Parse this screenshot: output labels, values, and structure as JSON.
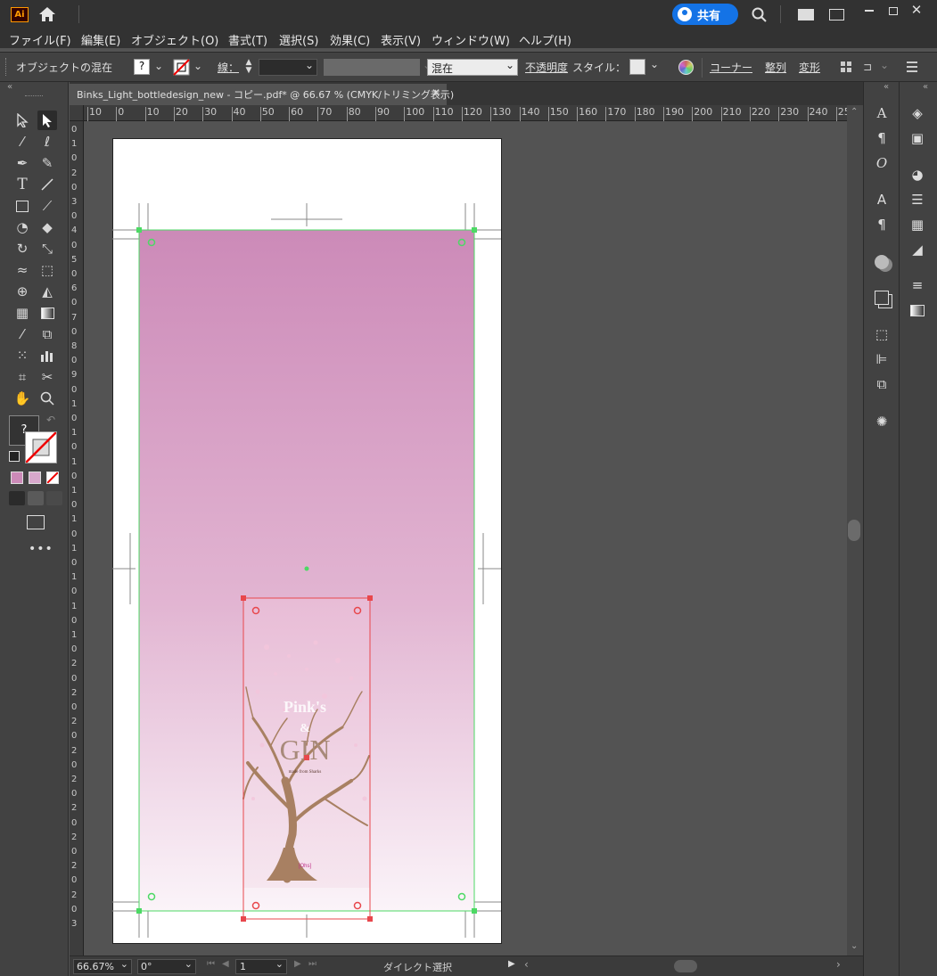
{
  "app": {
    "logo": "Ai",
    "share_label": "共有"
  },
  "menu": [
    "ファイル(F)",
    "編集(E)",
    "オブジェクト(O)",
    "書式(T)",
    "選択(S)",
    "効果(C)",
    "表示(V)",
    "ウィンドウ(W)",
    "ヘルプ(H)"
  ],
  "control": {
    "mode_label": "オブジェクトの混在",
    "fill_label": "?",
    "stroke_label": "線：",
    "blend_value": "混在",
    "opacity_label": "不透明度",
    "style_label": "スタイル：",
    "corner_label": "コーナー",
    "align_label": "整列",
    "transform_label": "変形"
  },
  "document": {
    "tab_title": "Binks_Light_bottledesign_new - コピー.pdf* @ 66.67 % (CMYK/トリミング表示)"
  },
  "ruler": {
    "h_ticks": [
      "10",
      "0",
      "10",
      "20",
      "30",
      "40",
      "50",
      "60",
      "70",
      "80",
      "90",
      "100",
      "110",
      "120",
      "130",
      "140",
      "150",
      "160",
      "170",
      "180",
      "190",
      "200",
      "210",
      "220",
      "230",
      "240",
      "25"
    ],
    "v_ticks": [
      "0",
      "1",
      "0",
      "2",
      "0",
      "3",
      "0",
      "4",
      "0",
      "5",
      "0",
      "6",
      "0",
      "7",
      "0",
      "8",
      "0",
      "9",
      "0",
      "1",
      "0",
      "1",
      "0",
      "1",
      "0",
      "1",
      "0",
      "1",
      "0",
      "1",
      "0",
      "1",
      "0",
      "1",
      "0",
      "1",
      "0",
      "2",
      "0",
      "2",
      "0",
      "2",
      "0",
      "2",
      "0",
      "2",
      "0",
      "2",
      "0",
      "2",
      "0",
      "2",
      "0",
      "2",
      "0",
      "3"
    ]
  },
  "artwork": {
    "label_title_line1": "Pink's",
    "label_title_line2": "&",
    "label_title_main": "GIN",
    "label_subtitle": "made from Sharks",
    "label_small": "[Ohs]"
  },
  "status": {
    "zoom": "66.67%",
    "rotation": "0°",
    "artboard": "1",
    "tool_name": "ダイレクト選択"
  },
  "colors": {
    "accent_blue": "#1473e6",
    "selection_green": "#4cd964",
    "selection_red": "#e8474c",
    "gradient_top": "#cc8ab8",
    "gradient_bottom": "#fbf4f9"
  }
}
